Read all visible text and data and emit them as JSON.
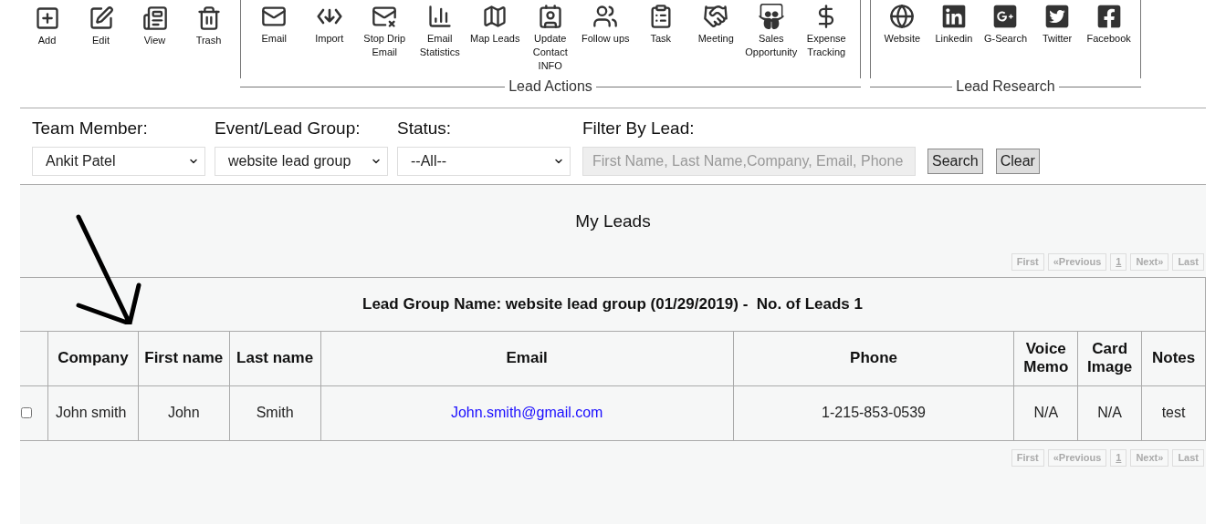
{
  "toolbar": {
    "main_actions": [
      {
        "label": "Add"
      },
      {
        "label": "Edit"
      },
      {
        "label": "View"
      },
      {
        "label": "Trash"
      }
    ],
    "lead_actions": {
      "title": "Lead Actions",
      "items": [
        {
          "label": "Email"
        },
        {
          "label": "Import"
        },
        {
          "label": "Stop Drip Email"
        },
        {
          "label": "Email Statistics"
        },
        {
          "label": "Map Leads"
        },
        {
          "label": "Update Contact INFO"
        },
        {
          "label": "Follow ups"
        },
        {
          "label": "Task"
        },
        {
          "label": "Meeting"
        },
        {
          "label": "Sales Opportunity"
        },
        {
          "label": "Expense Tracking"
        }
      ]
    },
    "lead_research": {
      "title": "Lead Research",
      "items": [
        {
          "label": "Website"
        },
        {
          "label": "Linkedin"
        },
        {
          "label": "G-Search"
        },
        {
          "label": "Twitter"
        },
        {
          "label": "Facebook"
        }
      ]
    }
  },
  "filters": {
    "team_member": {
      "label": "Team Member:",
      "value": "Ankit Patel"
    },
    "lead_group": {
      "label": "Event/Lead Group:",
      "value": "website lead group"
    },
    "status": {
      "label": "Status:",
      "value": "--All--"
    },
    "filter_by_lead": {
      "label": "Filter By Lead:",
      "placeholder": "First Name, Last Name,Company, Email, Phone"
    },
    "buttons": [
      "Search",
      "Clear"
    ]
  },
  "title": "My Leads",
  "pagination_top": [
    {
      "label": "First",
      "selected": false
    },
    {
      "label": "«Previous",
      "selected": false
    },
    {
      "label": "1",
      "selected": true
    },
    {
      "label": "Next»",
      "selected": false
    },
    {
      "label": "Last",
      "selected": false
    }
  ],
  "table": {
    "caption": "Lead Group Name: website lead group (01/29/2019) -  No. of Leads 1",
    "columns": [
      "Company",
      "First name",
      "Last name",
      "Email",
      "Phone",
      "Voice Memo",
      "Card Image",
      "Notes"
    ],
    "rows": [
      {
        "checked": false,
        "cells": [
          "John smith",
          "John",
          "Smith",
          "John.smith@gmail.com",
          "1-215-853-0539",
          "N/A",
          "N/A",
          "test"
        ]
      }
    ]
  },
  "pagination_bottom": [
    {
      "label": "First",
      "selected": false
    },
    {
      "label": "«Previous",
      "selected": false
    },
    {
      "label": "1",
      "selected": true
    },
    {
      "label": "Next»",
      "selected": false
    },
    {
      "label": "Last",
      "selected": false
    }
  ]
}
